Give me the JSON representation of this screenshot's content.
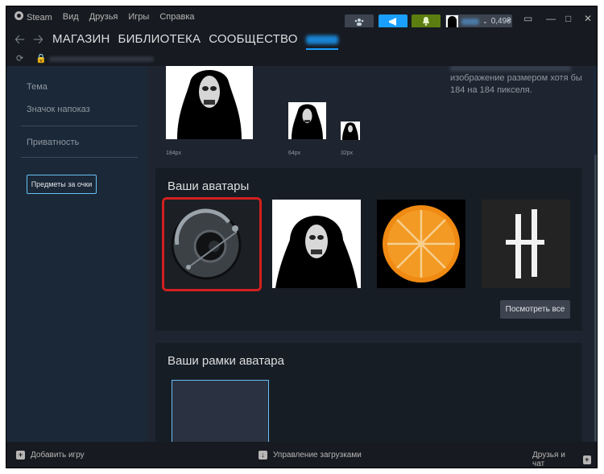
{
  "titlebar": {
    "menu": [
      "Steam",
      "Вид",
      "Друзья",
      "Игры",
      "Справка"
    ],
    "balance": "0,49₴",
    "icons": [
      "friends-icon",
      "megaphone-icon",
      "bell-icon"
    ]
  },
  "nav": {
    "links": [
      "МАГАЗИН",
      "БИБЛИОТЕКА",
      "СООБЩЕСТВО"
    ]
  },
  "sidebar": {
    "items": [
      "Тема",
      "Значок напоказ",
      "Приватность"
    ],
    "points_button": "Предметы за очки"
  },
  "preview": {
    "sizes": [
      "184px",
      "64px",
      "32px"
    ],
    "hint": "изображение размером хотя бы 184 на 184 пикселя."
  },
  "avatars_section": {
    "title": "Ваши аватары",
    "see_all": "Посмотреть все",
    "avatars": [
      "robot-sphere-avatar",
      "hooded-figure-avatar",
      "orange-slice-avatar",
      "dark-crosses-avatar"
    ]
  },
  "frames_section": {
    "title": "Ваши рамки аватара"
  },
  "bottombar": {
    "add_game": "Добавить игру",
    "downloads": "Управление загрузками",
    "friends_chat": "Друзья и чат"
  },
  "colors": {
    "accent": "#1a9fff",
    "selected_border": "#d31f1f",
    "notify_green": "#5c7e10"
  }
}
